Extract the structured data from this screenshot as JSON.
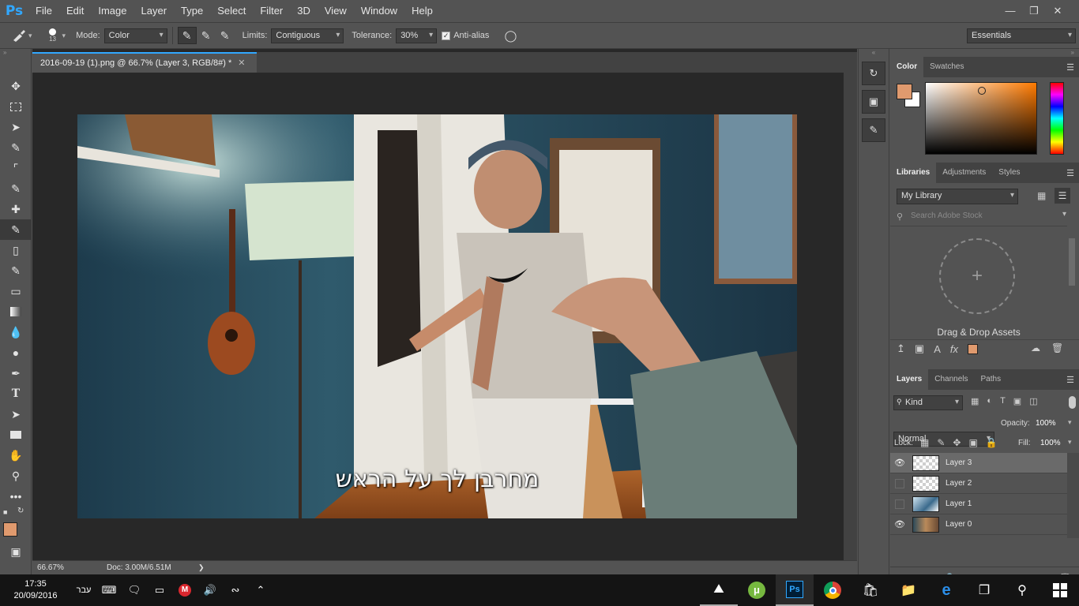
{
  "app": {
    "logo": "Ps"
  },
  "menu": [
    "File",
    "Edit",
    "Image",
    "Layer",
    "Type",
    "Select",
    "Filter",
    "3D",
    "View",
    "Window",
    "Help"
  ],
  "window_controls": {
    "minimize": "—",
    "restore": "❐",
    "close": "✕"
  },
  "options": {
    "brush_size": "13",
    "mode_label": "Mode:",
    "mode_value": "Color",
    "limits_label": "Limits:",
    "limits_value": "Contiguous",
    "tolerance_label": "Tolerance:",
    "tolerance_value": "30%",
    "antialias_label": "Anti-alias",
    "antialias_checked": true,
    "workspace": "Essentials"
  },
  "document": {
    "tab_title": "2016-09-19 (1).png @ 66.7% (Layer 3, RGB/8#) *",
    "subtitle_text": "מחרבן לך על הראש"
  },
  "status": {
    "zoom": "66.67%",
    "doc_size": "Doc: 3.00M/6.51M",
    "arrow": "❯"
  },
  "color_panel": {
    "tabs": [
      "Color",
      "Swatches"
    ],
    "foreground": "#e09a6e",
    "background": "#ffffff",
    "hue_base": "#ff7a00"
  },
  "libraries_panel": {
    "tabs": [
      "Libraries",
      "Adjustments",
      "Styles"
    ],
    "library_select": "My Library",
    "search_placeholder": "Search Adobe Stock",
    "drag_drop": "Drag & Drop Assets"
  },
  "layers_panel": {
    "tabs": [
      "Layers",
      "Channels",
      "Paths"
    ],
    "kind_label": "Kind",
    "blend_mode": "Normal",
    "opacity_label": "Opacity:",
    "opacity_value": "100%",
    "lock_label": "Lock:",
    "fill_label": "Fill:",
    "fill_value": "100%",
    "layers": [
      {
        "name": "Layer 3",
        "visible": true,
        "selected": true,
        "thumb": "transparent"
      },
      {
        "name": "Layer 2",
        "visible": false,
        "selected": false,
        "thumb": "transparent"
      },
      {
        "name": "Layer 1",
        "visible": false,
        "selected": false,
        "thumb": "photo-blue"
      },
      {
        "name": "Layer 0",
        "visible": true,
        "selected": false,
        "thumb": "photo-room"
      }
    ]
  },
  "taskbar": {
    "time": "17:35",
    "date": "20/09/2016",
    "language": "עבר"
  }
}
